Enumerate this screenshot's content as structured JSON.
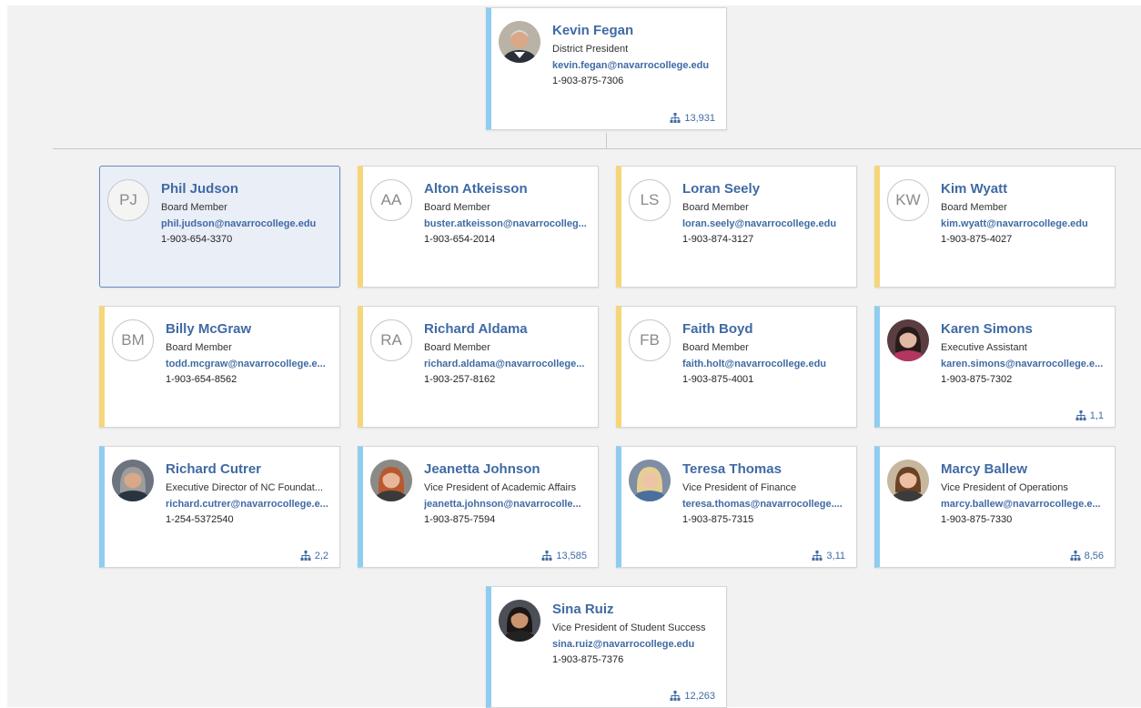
{
  "colors": {
    "accent_blue": "#8fcdf0",
    "accent_yellow": "#f7d679",
    "name_blue": "#3f6aa4",
    "selected_bg": "#e9eef7"
  },
  "root": {
    "name": "Kevin Fegan",
    "title": "District President",
    "email": "kevin.fegan@navarrocollege.edu",
    "phone": "1-903-875-7306",
    "count": "13,931",
    "avatar": "photo"
  },
  "cards": [
    {
      "name": "Phil Judson",
      "title": "Board Member",
      "email": "phil.judson@navarrocollege.edu",
      "phone": "1-903-654-3370",
      "initials": "PJ",
      "accent": "blue",
      "selected": true,
      "count": ""
    },
    {
      "name": "Alton Atkeisson",
      "title": "Board Member",
      "email": "buster.atkeisson@navarrocolleg...",
      "phone": "1-903-654-2014",
      "initials": "AA",
      "accent": "yellow",
      "count": ""
    },
    {
      "name": "Loran Seely",
      "title": "Board Member",
      "email": "loran.seely@navarrocollege.edu",
      "phone": "1-903-874-3127",
      "initials": "LS",
      "accent": "yellow",
      "count": ""
    },
    {
      "name": "Kim Wyatt",
      "title": "Board Member",
      "email": "kim.wyatt@navarrocollege.edu",
      "phone": "1-903-875-4027",
      "initials": "KW",
      "accent": "yellow",
      "count": ""
    },
    {
      "name": "Billy McGraw",
      "title": "Board Member",
      "email": "todd.mcgraw@navarrocollege.e...",
      "phone": "1-903-654-8562",
      "initials": "BM",
      "accent": "yellow",
      "count": ""
    },
    {
      "name": "Richard Aldama",
      "title": "Board Member",
      "email": "richard.aldama@navarrocollege...",
      "phone": "1-903-257-8162",
      "initials": "RA",
      "accent": "yellow",
      "count": ""
    },
    {
      "name": "Faith Boyd",
      "title": "Board Member",
      "email": "faith.holt@navarrocollege.edu",
      "phone": "1-903-875-4001",
      "initials": "FB",
      "accent": "yellow",
      "count": ""
    },
    {
      "name": "Karen Simons",
      "title": "Executive Assistant",
      "email": "karen.simons@navarrocollege.e...",
      "phone": "1-903-875-7302",
      "initials": "",
      "photo": "f-dark",
      "accent": "blue",
      "count": "1,1"
    },
    {
      "name": "Richard Cutrer",
      "title": "Executive Director of NC Foundat...",
      "email": "richard.cutrer@navarrocollege.e...",
      "phone": "1-254-5372540",
      "initials": "",
      "photo": "m-gray",
      "accent": "blue",
      "count": "2,2"
    },
    {
      "name": "Jeanetta Johnson",
      "title": "Vice President of Academic Affairs",
      "email": "jeanetta.johnson@navarrocolle...",
      "phone": "1-903-875-7594",
      "initials": "",
      "photo": "f-red",
      "accent": "blue",
      "count": "13,585"
    },
    {
      "name": "Teresa Thomas",
      "title": "Vice President of Finance",
      "email": "teresa.thomas@navarrocollege....",
      "phone": "1-903-875-7315",
      "initials": "",
      "photo": "f-blonde",
      "accent": "blue",
      "count": "3,11"
    },
    {
      "name": "Marcy Ballew",
      "title": "Vice President of Operations",
      "email": "marcy.ballew@navarrocollege.e...",
      "phone": "1-903-875-7330",
      "initials": "",
      "photo": "f-brown",
      "accent": "blue",
      "count": "8,56"
    },
    {
      "name": "Sina Ruiz",
      "title": "Vice President of Student Success",
      "email": "sina.ruiz@navarrocollege.edu",
      "phone": "1-903-875-7376",
      "initials": "",
      "photo": "f-black",
      "accent": "blue",
      "count": "12,263"
    }
  ]
}
